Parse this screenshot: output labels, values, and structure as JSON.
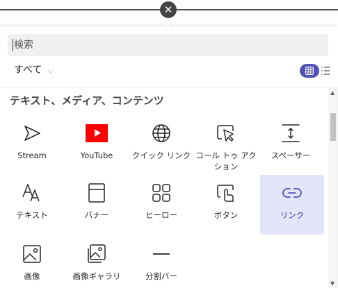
{
  "close": {
    "icon": "close-icon",
    "glyph": "✕"
  },
  "search": {
    "placeholder": "検索"
  },
  "filter": {
    "label": "すべて",
    "chevron": "⌵"
  },
  "view": {
    "grid_icon": "grid-view-icon",
    "list_icon": "list-view-icon",
    "active": "grid",
    "accent": "#4f52b2"
  },
  "section": {
    "title": "テキスト、メディア、コンテンツ"
  },
  "tiles": [
    {
      "label": "Stream",
      "icon": "stream-icon"
    },
    {
      "label": "YouTube",
      "icon": "youtube-icon"
    },
    {
      "label": "クイック リンク",
      "icon": "globe-icon"
    },
    {
      "label": "コール トゥ アクション",
      "icon": "cursor-click-icon"
    },
    {
      "label": "スペーサー",
      "icon": "spacer-icon"
    },
    {
      "label": "テキスト",
      "icon": "text-icon"
    },
    {
      "label": "バナー",
      "icon": "banner-icon"
    },
    {
      "label": "ヒーロー",
      "icon": "hero-icon"
    },
    {
      "label": "ボタン",
      "icon": "button-icon"
    },
    {
      "label": "リンク",
      "icon": "link-icon",
      "selected": true
    },
    {
      "label": "画像",
      "icon": "image-icon"
    },
    {
      "label": "画像ギャラリ",
      "icon": "image-gallery-icon"
    },
    {
      "label": "分割バー",
      "icon": "divider-icon"
    }
  ]
}
